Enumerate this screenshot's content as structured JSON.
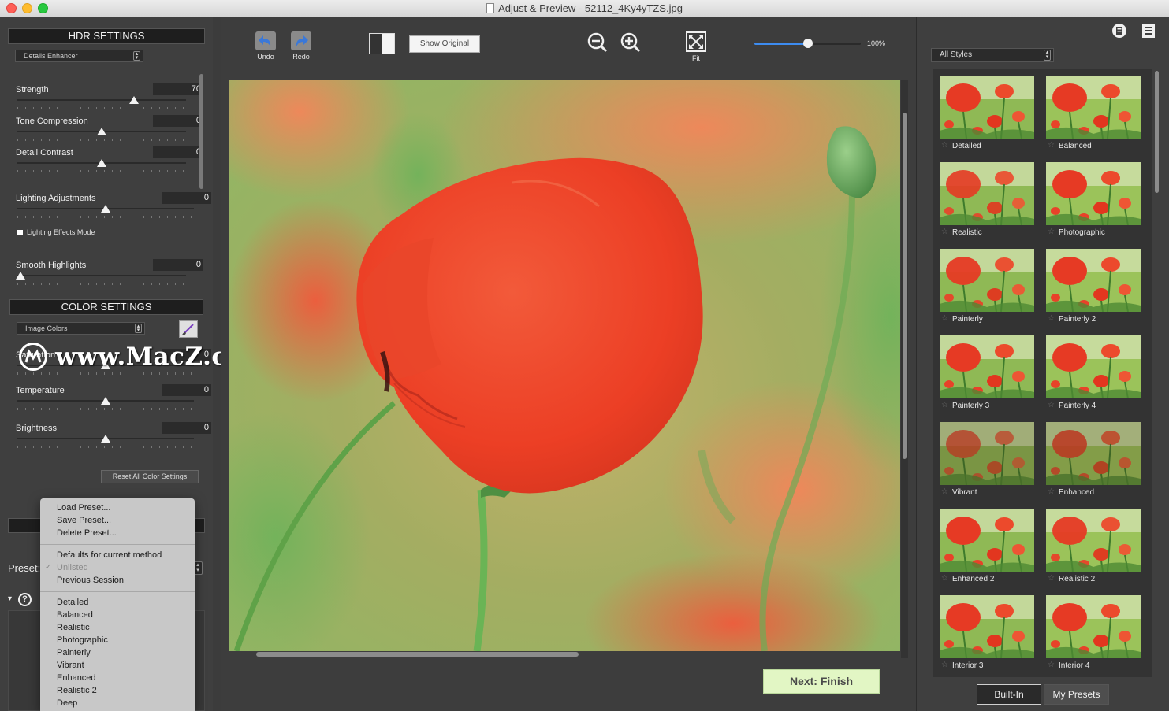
{
  "window": {
    "title": "Adjust & Preview - 52112_4Ky4yTZS.jpg"
  },
  "hdr": {
    "header": "HDR SETTINGS",
    "method": "Details Enhancer",
    "sliders": [
      {
        "label": "Strength",
        "value": "70",
        "position": 0.7
      },
      {
        "label": "Tone Compression",
        "value": "0",
        "position": 0.5
      },
      {
        "label": "Detail Contrast",
        "value": "0",
        "position": 0.5
      },
      {
        "label": "Lighting Adjustments",
        "value": "0",
        "position": 0.5
      },
      {
        "label": "Smooth Highlights",
        "value": "0",
        "position": 0.0
      }
    ],
    "lighting_effects_mode": "Lighting Effects Mode"
  },
  "color": {
    "header": "COLOR SETTINGS",
    "mode": "Image Colors",
    "sliders": [
      {
        "label": "Saturation",
        "value": "0",
        "position": 0.5
      },
      {
        "label": "Temperature",
        "value": "0",
        "position": 0.5
      },
      {
        "label": "Brightness",
        "value": "0",
        "position": 0.5
      }
    ],
    "reset_button": "Reset All Color Settings"
  },
  "watermark": "www.MacZ.com",
  "preset": {
    "label": "Preset:",
    "menu": {
      "actions": [
        "Load Preset...",
        "Save Preset...",
        "Delete Preset..."
      ],
      "defaults": "Defaults for current method",
      "unlisted": "Unlisted",
      "previous": "Previous Session",
      "presets": [
        "Detailed",
        "Balanced",
        "Realistic",
        "Photographic",
        "Painterly",
        "Vibrant",
        "Enhanced",
        "Realistic 2",
        "Deep"
      ]
    }
  },
  "toolbar": {
    "undo": "Undo",
    "redo": "Redo",
    "show_original": "Show Original",
    "fit": "Fit",
    "zoom": "100%",
    "zoom_level": 0.5
  },
  "next_button": "Next: Finish",
  "styles": {
    "filter": "All Styles",
    "items": [
      "Detailed",
      "Balanced",
      "Realistic",
      "Photographic",
      "Painterly",
      "Painterly 2",
      "Painterly 3",
      "Painterly 4",
      "Vibrant",
      "Enhanced",
      "Enhanced 2",
      "Realistic 2",
      "Interior 3",
      "Interior 4"
    ],
    "tabs": {
      "builtin": "Built-In",
      "mypresets": "My Presets"
    }
  },
  "colors": {
    "accent": "#3d8cf0",
    "next_button_bg": "#e2f6c4",
    "poppy": "#f0432a"
  }
}
